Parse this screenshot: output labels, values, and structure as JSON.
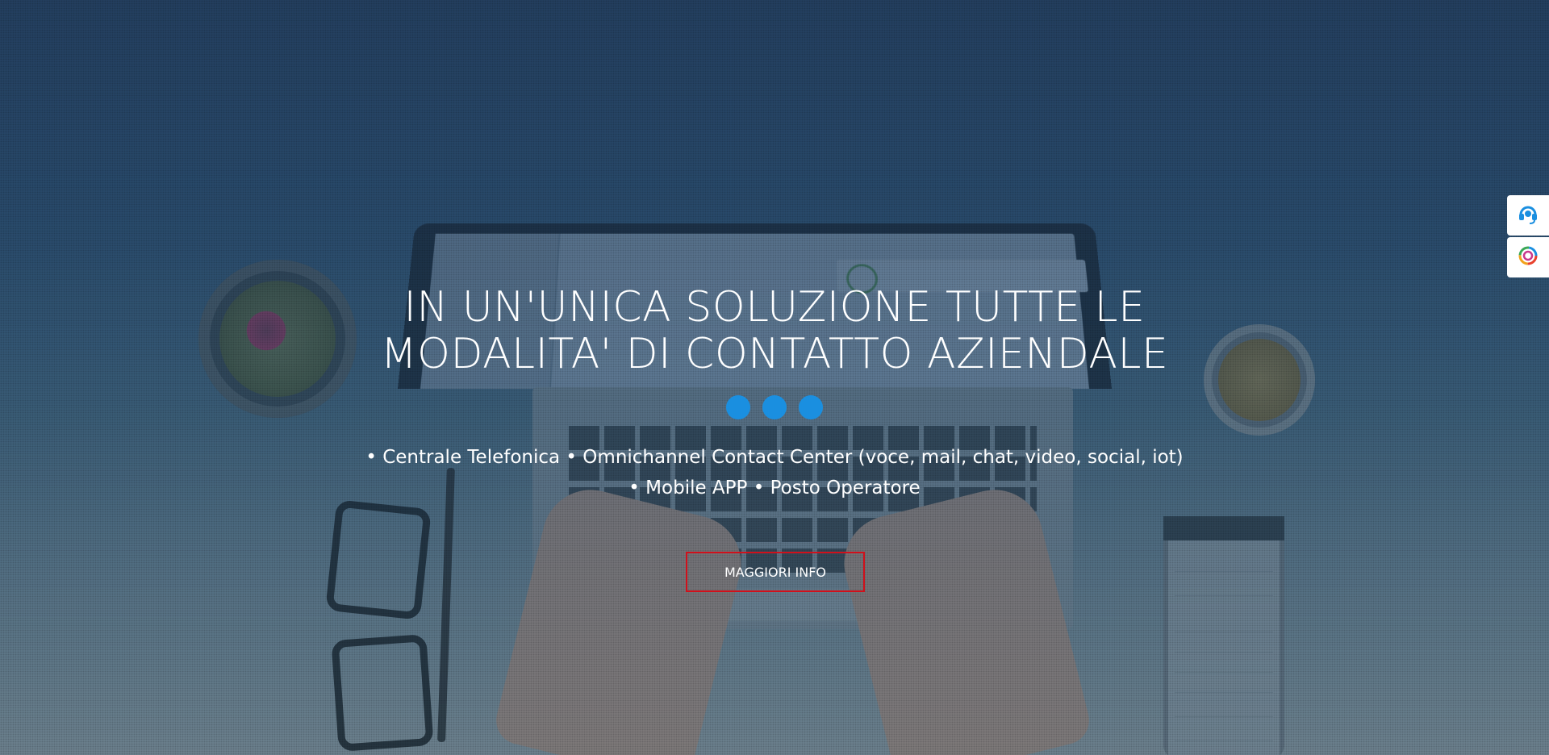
{
  "hero": {
    "headline_line1": "IN UN'UNICA SOLUZIONE TUTTE LE",
    "headline_line2": "MODALITA' DI CONTATTO AZIENDALE",
    "features_line1": "• Centrale Telefonica • Omnichannel Contact Center (voce, mail, chat, video, social, iot)",
    "features_line2": "• Mobile APP • Posto Operatore",
    "cta_label": "MAGGIORI INFO",
    "slider_dots_count": 3
  },
  "colors": {
    "dot": "#1a8fe0",
    "cta_border": "#d0101b",
    "headline": "#ffffff"
  },
  "side_widgets": [
    {
      "icon": "headset-support-icon"
    },
    {
      "icon": "color-swirl-logo-icon"
    }
  ]
}
